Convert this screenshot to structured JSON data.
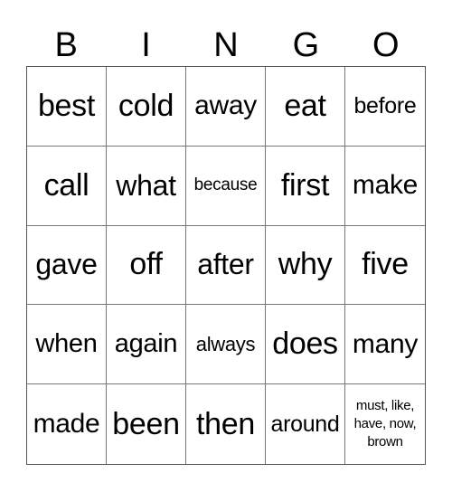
{
  "header": {
    "letters": [
      "B",
      "I",
      "N",
      "G",
      "O"
    ]
  },
  "grid": {
    "rows": [
      [
        "best",
        "cold",
        "away",
        "eat",
        "before"
      ],
      [
        "call",
        "what",
        "because",
        "first",
        "make"
      ],
      [
        "gave",
        "off",
        "after",
        "why",
        "five"
      ],
      [
        "when",
        "again",
        "always",
        "does",
        "many"
      ],
      [
        "made",
        "been",
        "then",
        "around",
        "must, like, have, now, brown"
      ]
    ]
  }
}
